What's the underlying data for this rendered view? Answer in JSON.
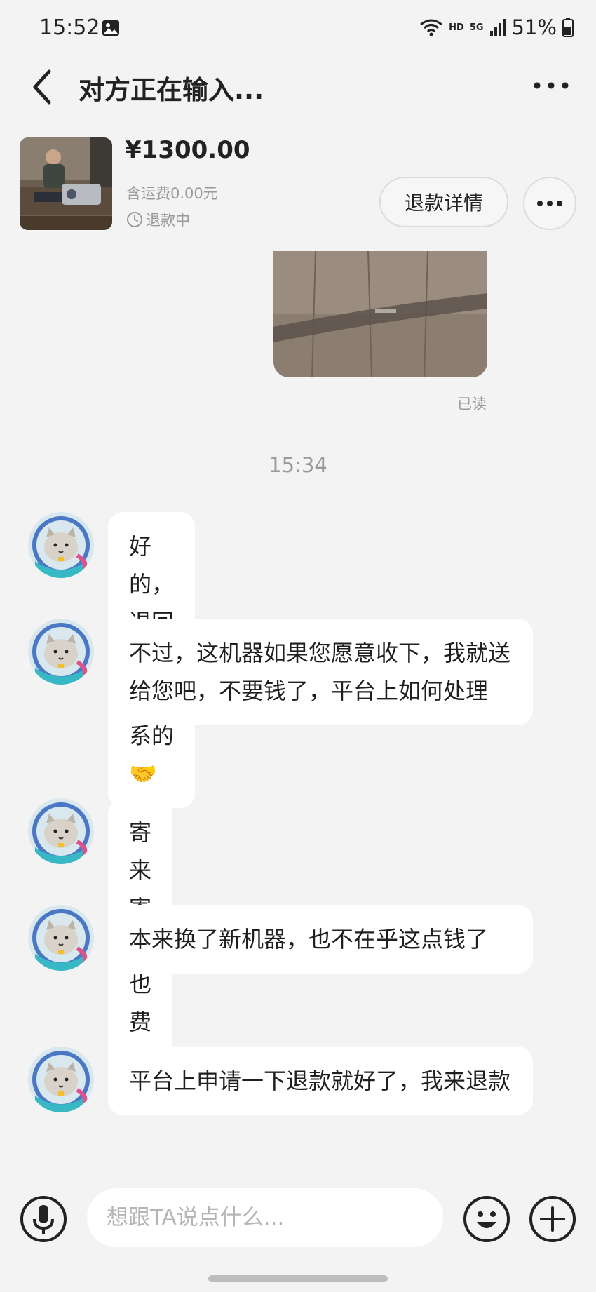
{
  "status_bar": {
    "time": "15:52",
    "network_hd": "HD",
    "network_5g": "5G",
    "battery": "51%",
    "icons": [
      "image-icon",
      "wifi-icon",
      "signal-icon",
      "battery-icon"
    ]
  },
  "header": {
    "title": "对方正在输入...",
    "icons": [
      "back-arrow-icon",
      "more-dots-icon"
    ]
  },
  "product": {
    "price": "¥1300.00",
    "shipping": "含运费0.00元",
    "status": "退款中",
    "refund_detail_label": "退款详情",
    "icons": [
      "clock-icon",
      "more-dots-icon"
    ]
  },
  "chat": {
    "read_receipt": "已读",
    "time_divider": "15:34",
    "messages": [
      {
        "text": "好的，退回吧，没关系的",
        "emoji": "🤝"
      },
      {
        "text": "不过，这机器如果您愿意收下，我就送给您吧，不要钱了，平台上如何处理"
      },
      {
        "text": "寄来寄去也费钱"
      },
      {
        "text": "本来换了新机器，也不在乎这点钱了"
      },
      {
        "text": "平台上申请一下退款就好了，我来退款"
      }
    ]
  },
  "input_bar": {
    "placeholder": "想跟TA说点什么...",
    "value": "",
    "icons": [
      "microphone-icon",
      "emoji-icon",
      "plus-icon"
    ]
  },
  "colors": {
    "background": "#f3f3f3",
    "bubble": "#ffffff",
    "muted_text": "#9a9a9a"
  }
}
